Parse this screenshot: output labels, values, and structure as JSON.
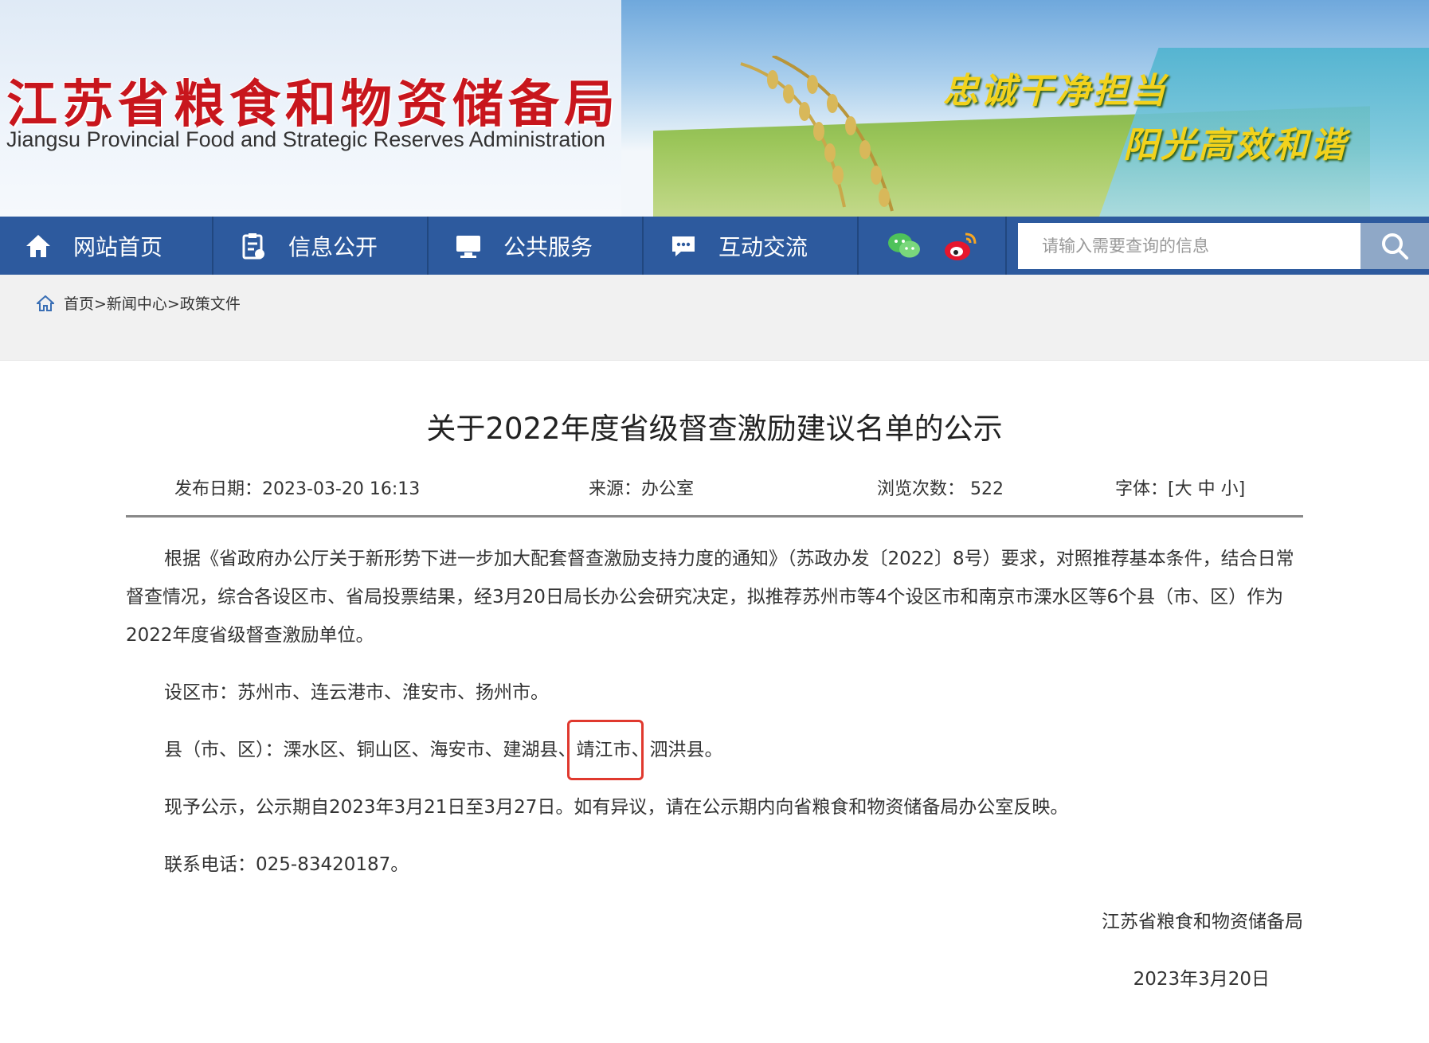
{
  "header": {
    "title": "江苏省粮食和物资储备局",
    "subtitle": "Jiangsu Provincial Food and Strategic Reserves Administration",
    "slogan1": "忠诚干净担当",
    "slogan2": "阳光高效和谐"
  },
  "nav": {
    "items": [
      {
        "label": "网站首页",
        "icon": "home-icon"
      },
      {
        "label": "信息公开",
        "icon": "clipboard-icon"
      },
      {
        "label": "公共服务",
        "icon": "monitor-icon"
      },
      {
        "label": "互动交流",
        "icon": "chat-icon"
      }
    ],
    "social": [
      "wechat-icon",
      "weibo-icon"
    ],
    "search_placeholder": "请输入需要查询的信息"
  },
  "breadcrumb": {
    "home": "首页>",
    "news": "新闻中心>",
    "current": "政策文件"
  },
  "article": {
    "title": "关于2022年度省级督查激励建议名单的公示",
    "meta": {
      "date_label": "发布日期：",
      "date": "2023-03-20 16:13",
      "source_label": "来源：",
      "source": "办公室",
      "views_label": "浏览次数：",
      "views": "522",
      "font_label": "字体：[",
      "font_large": "大",
      "font_medium": "中",
      "font_small": "小",
      "font_close": "]"
    },
    "paragraph1": "根据《省政府办公厅关于新形势下进一步加大配套督查激励支持力度的通知》（苏政办发〔2022〕8号）要求，对照推荐基本条件，结合日常督查情况，综合各设区市、省局投票结果，经3月20日局长办公会研究决定，拟推荐苏州市等4个设区市和南京市溧水区等6个县（市、区）作为2022年度省级督查激励单位。",
    "cities": "设区市：苏州市、连云港市、淮安市、扬州市。",
    "counties_prefix": "县（市、区）：溧水区、铜山区、海安市、建湖县、",
    "counties_highlight": "靖江市",
    "counties_suffix": "、泗洪县。",
    "notice": "现予公示，公示期自2023年3月21日至3月27日。如有异议，请在公示期内向省粮食和物资储备局办公室反映。",
    "phone": "联系电话：025-83420187。",
    "signature": "江苏省粮食和物资储备局",
    "sign_date": "2023年3月20日"
  },
  "colors": {
    "nav_bg": "#2d5a9e",
    "title_red": "#c8161d",
    "highlight_box": "#e0392e"
  }
}
